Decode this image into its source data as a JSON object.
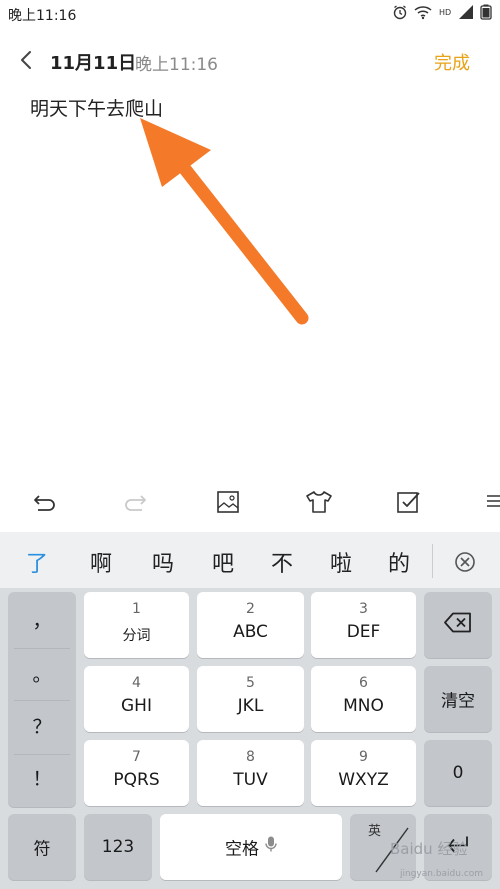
{
  "status_bar": {
    "time": "晚上11:16",
    "icons": [
      "alarm-icon",
      "wifi-icon",
      "hd-icon",
      "signal-icon",
      "battery-icon"
    ]
  },
  "header": {
    "back_icon": "chevron-left-icon",
    "date": "11月11日",
    "time": "晚上11:16",
    "done_label": "完成",
    "done_color": "#e8a317"
  },
  "note": {
    "text": "明天下午去爬山"
  },
  "annotation": {
    "arrow_color": "#f47a2a"
  },
  "format_toolbar": {
    "items": [
      "undo-icon",
      "redo-icon",
      "image-icon",
      "shirt-icon",
      "checkbox-icon",
      "list-icon"
    ]
  },
  "keyboard": {
    "candidates": [
      "了",
      "啊",
      "吗",
      "吧",
      "不",
      "啦",
      "的"
    ],
    "candidate_highlight_color": "#2b8fe0",
    "punctuation": [
      "，",
      "。",
      "？",
      "！"
    ],
    "keys": [
      {
        "num": "1",
        "label": "分词"
      },
      {
        "num": "2",
        "label": "ABC"
      },
      {
        "num": "3",
        "label": "DEF"
      },
      {
        "num": "4",
        "label": "GHI"
      },
      {
        "num": "5",
        "label": "JKL"
      },
      {
        "num": "6",
        "label": "MNO"
      },
      {
        "num": "7",
        "label": "PQRS"
      },
      {
        "num": "8",
        "label": "TUV"
      },
      {
        "num": "9",
        "label": "WXYZ"
      }
    ],
    "clear_label": "清空",
    "zero_label": "0",
    "symbol_label": "符",
    "numbers_label": "123",
    "space_label": "空格",
    "lang_label": "英",
    "enter_icon": "enter-icon",
    "backspace_icon": "backspace-icon"
  },
  "watermark": {
    "text": "Baidu 经验",
    "sub": "jingyan.baidu.com"
  }
}
